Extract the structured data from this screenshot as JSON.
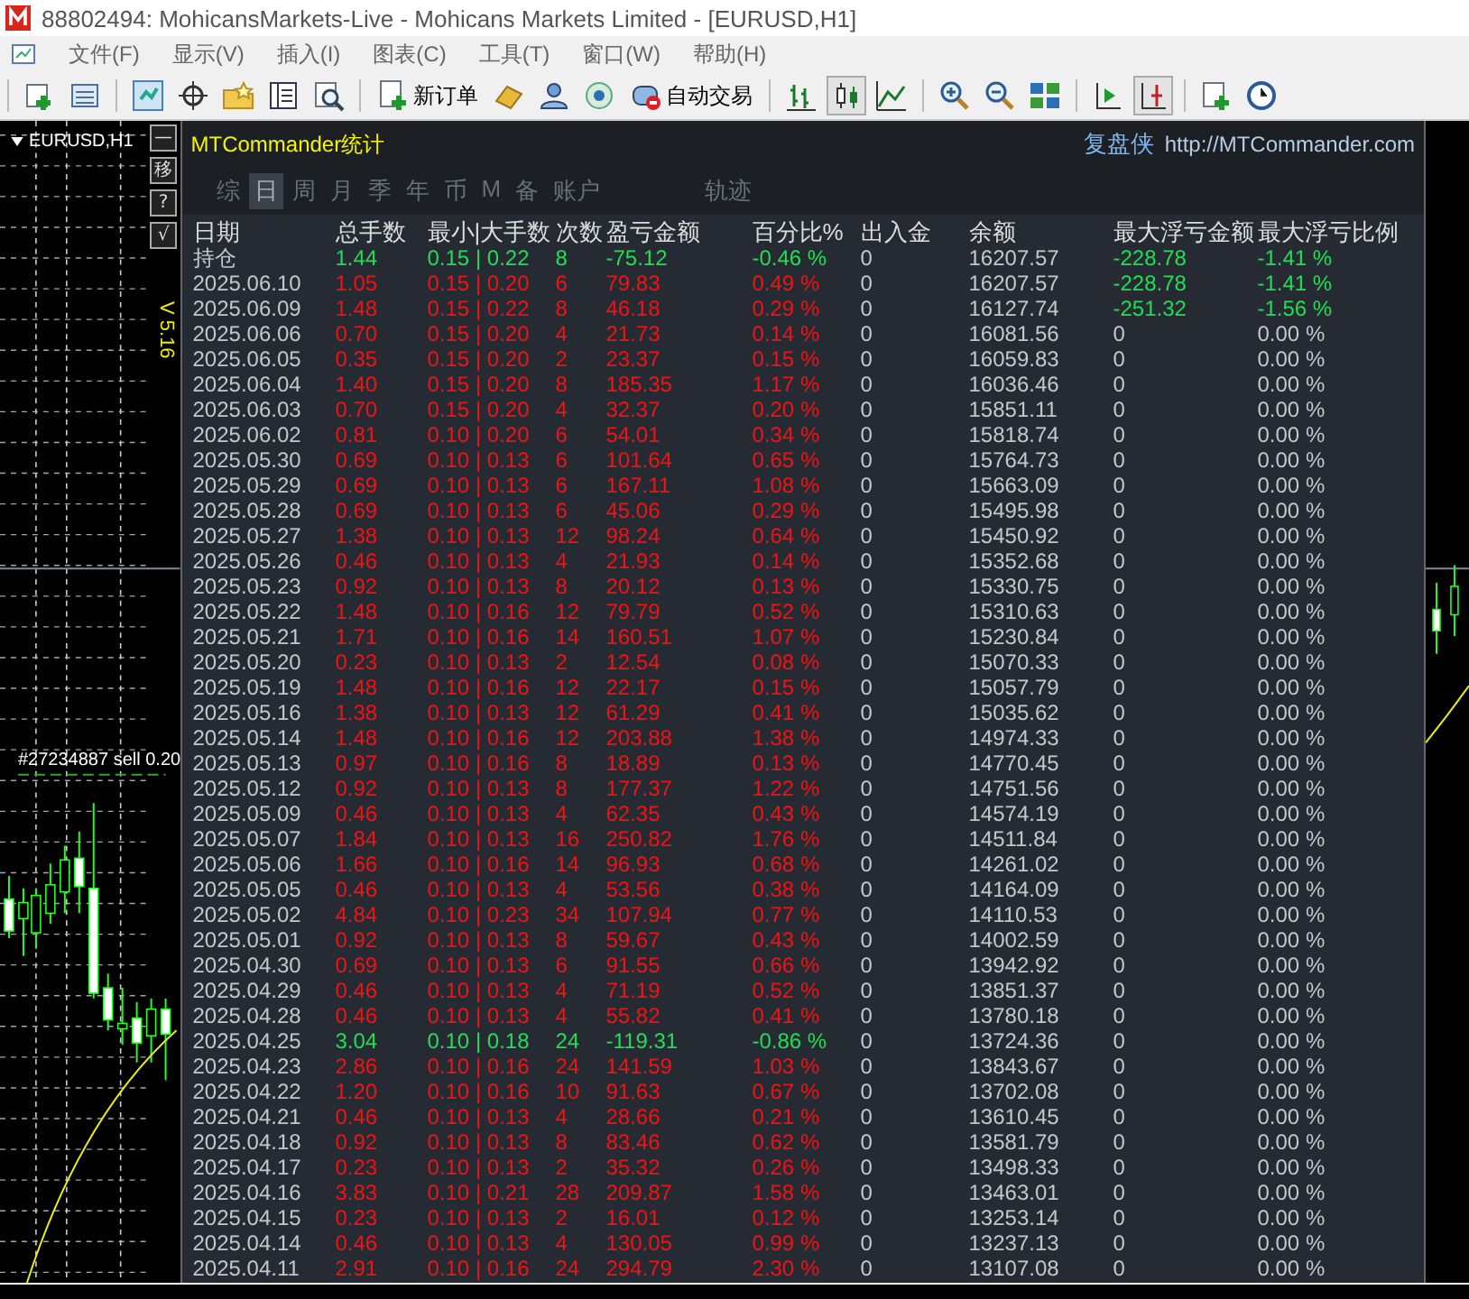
{
  "window": {
    "title": "88802494: MohicansMarkets-Live - Mohicans Markets Limited - [EURUSD,H1]"
  },
  "menu": [
    "文件(F)",
    "显示(V)",
    "插入(I)",
    "图表(C)",
    "工具(T)",
    "窗口(W)",
    "帮助(H)"
  ],
  "toolbar_buttons": [
    {
      "label": "新订单"
    },
    {
      "label": "自动交易"
    }
  ],
  "chart": {
    "symbol": "EURUSD,H1",
    "order_label": "#27234887 sell 0.20",
    "version": "V 5.16",
    "side_buttons": [
      "—",
      "移",
      "?",
      "√"
    ]
  },
  "stats_panel": {
    "title": "MTCommander统计",
    "brand": "复盘侠",
    "link": "http://MTCommander.com",
    "tabs": [
      {
        "label": "综",
        "selected": false
      },
      {
        "label": "日",
        "selected": true
      },
      {
        "label": "周",
        "selected": false
      },
      {
        "label": "月",
        "selected": false
      },
      {
        "label": "季",
        "selected": false
      },
      {
        "label": "年",
        "selected": false
      },
      {
        "label": "币",
        "selected": false
      },
      {
        "label": "M",
        "selected": false
      },
      {
        "label": "备",
        "selected": false
      },
      {
        "label": "账户",
        "selected": false
      },
      {
        "label": "轨迹",
        "selected": false
      }
    ],
    "columns": [
      "日期",
      "总手数",
      "最小|大手数",
      "次数",
      "盈亏金额",
      "百分比%",
      "出入金",
      "余额",
      "最大浮亏金额",
      "最大浮亏比例"
    ],
    "rows": [
      {
        "cells": [
          "持仓",
          "1.44",
          "0.15 | 0.22",
          "8",
          "-75.12",
          "-0.46 %",
          "0",
          "16207.57",
          "-228.78",
          "-1.41 %"
        ],
        "loss": true,
        "drawdown": true
      },
      {
        "cells": [
          "2025.06.10",
          "1.05",
          "0.15 | 0.20",
          "6",
          "79.83",
          "0.49 %",
          "0",
          "16207.57",
          "-228.78",
          "-1.41 %"
        ],
        "loss": false,
        "drawdown": true
      },
      {
        "cells": [
          "2025.06.09",
          "1.48",
          "0.15 | 0.22",
          "8",
          "46.18",
          "0.29 %",
          "0",
          "16127.74",
          "-251.32",
          "-1.56 %"
        ],
        "loss": false,
        "drawdown": true
      },
      {
        "cells": [
          "2025.06.06",
          "0.70",
          "0.15 | 0.20",
          "4",
          "21.73",
          "0.14 %",
          "0",
          "16081.56",
          "0",
          "0.00 %"
        ],
        "loss": false,
        "drawdown": false
      },
      {
        "cells": [
          "2025.06.05",
          "0.35",
          "0.15 | 0.20",
          "2",
          "23.37",
          "0.15 %",
          "0",
          "16059.83",
          "0",
          "0.00 %"
        ],
        "loss": false,
        "drawdown": false
      },
      {
        "cells": [
          "2025.06.04",
          "1.40",
          "0.15 | 0.20",
          "8",
          "185.35",
          "1.17 %",
          "0",
          "16036.46",
          "0",
          "0.00 %"
        ],
        "loss": false,
        "drawdown": false
      },
      {
        "cells": [
          "2025.06.03",
          "0.70",
          "0.15 | 0.20",
          "4",
          "32.37",
          "0.20 %",
          "0",
          "15851.11",
          "0",
          "0.00 %"
        ],
        "loss": false,
        "drawdown": false
      },
      {
        "cells": [
          "2025.06.02",
          "0.81",
          "0.10 | 0.20",
          "6",
          "54.01",
          "0.34 %",
          "0",
          "15818.74",
          "0",
          "0.00 %"
        ],
        "loss": false,
        "drawdown": false
      },
      {
        "cells": [
          "2025.05.30",
          "0.69",
          "0.10 | 0.13",
          "6",
          "101.64",
          "0.65 %",
          "0",
          "15764.73",
          "0",
          "0.00 %"
        ],
        "loss": false,
        "drawdown": false
      },
      {
        "cells": [
          "2025.05.29",
          "0.69",
          "0.10 | 0.13",
          "6",
          "167.11",
          "1.08 %",
          "0",
          "15663.09",
          "0",
          "0.00 %"
        ],
        "loss": false,
        "drawdown": false
      },
      {
        "cells": [
          "2025.05.28",
          "0.69",
          "0.10 | 0.13",
          "6",
          "45.06",
          "0.29 %",
          "0",
          "15495.98",
          "0",
          "0.00 %"
        ],
        "loss": false,
        "drawdown": false
      },
      {
        "cells": [
          "2025.05.27",
          "1.38",
          "0.10 | 0.13",
          "12",
          "98.24",
          "0.64 %",
          "0",
          "15450.92",
          "0",
          "0.00 %"
        ],
        "loss": false,
        "drawdown": false
      },
      {
        "cells": [
          "2025.05.26",
          "0.46",
          "0.10 | 0.13",
          "4",
          "21.93",
          "0.14 %",
          "0",
          "15352.68",
          "0",
          "0.00 %"
        ],
        "loss": false,
        "drawdown": false
      },
      {
        "cells": [
          "2025.05.23",
          "0.92",
          "0.10 | 0.13",
          "8",
          "20.12",
          "0.13 %",
          "0",
          "15330.75",
          "0",
          "0.00 %"
        ],
        "loss": false,
        "drawdown": false
      },
      {
        "cells": [
          "2025.05.22",
          "1.48",
          "0.10 | 0.16",
          "12",
          "79.79",
          "0.52 %",
          "0",
          "15310.63",
          "0",
          "0.00 %"
        ],
        "loss": false,
        "drawdown": false
      },
      {
        "cells": [
          "2025.05.21",
          "1.71",
          "0.10 | 0.16",
          "14",
          "160.51",
          "1.07 %",
          "0",
          "15230.84",
          "0",
          "0.00 %"
        ],
        "loss": false,
        "drawdown": false
      },
      {
        "cells": [
          "2025.05.20",
          "0.23",
          "0.10 | 0.13",
          "2",
          "12.54",
          "0.08 %",
          "0",
          "15070.33",
          "0",
          "0.00 %"
        ],
        "loss": false,
        "drawdown": false
      },
      {
        "cells": [
          "2025.05.19",
          "1.48",
          "0.10 | 0.16",
          "12",
          "22.17",
          "0.15 %",
          "0",
          "15057.79",
          "0",
          "0.00 %"
        ],
        "loss": false,
        "drawdown": false
      },
      {
        "cells": [
          "2025.05.16",
          "1.38",
          "0.10 | 0.13",
          "12",
          "61.29",
          "0.41 %",
          "0",
          "15035.62",
          "0",
          "0.00 %"
        ],
        "loss": false,
        "drawdown": false
      },
      {
        "cells": [
          "2025.05.14",
          "1.48",
          "0.10 | 0.16",
          "12",
          "203.88",
          "1.38 %",
          "0",
          "14974.33",
          "0",
          "0.00 %"
        ],
        "loss": false,
        "drawdown": false
      },
      {
        "cells": [
          "2025.05.13",
          "0.97",
          "0.10 | 0.16",
          "8",
          "18.89",
          "0.13 %",
          "0",
          "14770.45",
          "0",
          "0.00 %"
        ],
        "loss": false,
        "drawdown": false
      },
      {
        "cells": [
          "2025.05.12",
          "0.92",
          "0.10 | 0.13",
          "8",
          "177.37",
          "1.22 %",
          "0",
          "14751.56",
          "0",
          "0.00 %"
        ],
        "loss": false,
        "drawdown": false
      },
      {
        "cells": [
          "2025.05.09",
          "0.46",
          "0.10 | 0.13",
          "4",
          "62.35",
          "0.43 %",
          "0",
          "14574.19",
          "0",
          "0.00 %"
        ],
        "loss": false,
        "drawdown": false
      },
      {
        "cells": [
          "2025.05.07",
          "1.84",
          "0.10 | 0.13",
          "16",
          "250.82",
          "1.76 %",
          "0",
          "14511.84",
          "0",
          "0.00 %"
        ],
        "loss": false,
        "drawdown": false
      },
      {
        "cells": [
          "2025.05.06",
          "1.66",
          "0.10 | 0.16",
          "14",
          "96.93",
          "0.68 %",
          "0",
          "14261.02",
          "0",
          "0.00 %"
        ],
        "loss": false,
        "drawdown": false
      },
      {
        "cells": [
          "2025.05.05",
          "0.46",
          "0.10 | 0.13",
          "4",
          "53.56",
          "0.38 %",
          "0",
          "14164.09",
          "0",
          "0.00 %"
        ],
        "loss": false,
        "drawdown": false
      },
      {
        "cells": [
          "2025.05.02",
          "4.84",
          "0.10 | 0.23",
          "34",
          "107.94",
          "0.77 %",
          "0",
          "14110.53",
          "0",
          "0.00 %"
        ],
        "loss": false,
        "drawdown": false
      },
      {
        "cells": [
          "2025.05.01",
          "0.92",
          "0.10 | 0.13",
          "8",
          "59.67",
          "0.43 %",
          "0",
          "14002.59",
          "0",
          "0.00 %"
        ],
        "loss": false,
        "drawdown": false
      },
      {
        "cells": [
          "2025.04.30",
          "0.69",
          "0.10 | 0.13",
          "6",
          "91.55",
          "0.66 %",
          "0",
          "13942.92",
          "0",
          "0.00 %"
        ],
        "loss": false,
        "drawdown": false
      },
      {
        "cells": [
          "2025.04.29",
          "0.46",
          "0.10 | 0.13",
          "4",
          "71.19",
          "0.52 %",
          "0",
          "13851.37",
          "0",
          "0.00 %"
        ],
        "loss": false,
        "drawdown": false
      },
      {
        "cells": [
          "2025.04.28",
          "0.46",
          "0.10 | 0.13",
          "4",
          "55.82",
          "0.41 %",
          "0",
          "13780.18",
          "0",
          "0.00 %"
        ],
        "loss": false,
        "drawdown": false
      },
      {
        "cells": [
          "2025.04.25",
          "3.04",
          "0.10 | 0.18",
          "24",
          "-119.31",
          "-0.86 %",
          "0",
          "13724.36",
          "0",
          "0.00 %"
        ],
        "loss": true,
        "drawdown": false
      },
      {
        "cells": [
          "2025.04.23",
          "2.86",
          "0.10 | 0.16",
          "24",
          "141.59",
          "1.03 %",
          "0",
          "13843.67",
          "0",
          "0.00 %"
        ],
        "loss": false,
        "drawdown": false
      },
      {
        "cells": [
          "2025.04.22",
          "1.20",
          "0.10 | 0.16",
          "10",
          "91.63",
          "0.67 %",
          "0",
          "13702.08",
          "0",
          "0.00 %"
        ],
        "loss": false,
        "drawdown": false
      },
      {
        "cells": [
          "2025.04.21",
          "0.46",
          "0.10 | 0.13",
          "4",
          "28.66",
          "0.21 %",
          "0",
          "13610.45",
          "0",
          "0.00 %"
        ],
        "loss": false,
        "drawdown": false
      },
      {
        "cells": [
          "2025.04.18",
          "0.92",
          "0.10 | 0.13",
          "8",
          "83.46",
          "0.62 %",
          "0",
          "13581.79",
          "0",
          "0.00 %"
        ],
        "loss": false,
        "drawdown": false
      },
      {
        "cells": [
          "2025.04.17",
          "0.23",
          "0.10 | 0.13",
          "2",
          "35.32",
          "0.26 %",
          "0",
          "13498.33",
          "0",
          "0.00 %"
        ],
        "loss": false,
        "drawdown": false
      },
      {
        "cells": [
          "2025.04.16",
          "3.83",
          "0.10 | 0.21",
          "28",
          "209.87",
          "1.58 %",
          "0",
          "13463.01",
          "0",
          "0.00 %"
        ],
        "loss": false,
        "drawdown": false
      },
      {
        "cells": [
          "2025.04.15",
          "0.23",
          "0.10 | 0.13",
          "2",
          "16.01",
          "0.12 %",
          "0",
          "13253.14",
          "0",
          "0.00 %"
        ],
        "loss": false,
        "drawdown": false
      },
      {
        "cells": [
          "2025.04.14",
          "0.46",
          "0.10 | 0.13",
          "4",
          "130.05",
          "0.99 %",
          "0",
          "13237.13",
          "0",
          "0.00 %"
        ],
        "loss": false,
        "drawdown": false
      },
      {
        "cells": [
          "2025.04.11",
          "2.91",
          "0.10 | 0.16",
          "24",
          "294.79",
          "2.30 %",
          "0",
          "13107.08",
          "0",
          "0.00 %"
        ],
        "loss": false,
        "drawdown": false
      }
    ]
  }
}
